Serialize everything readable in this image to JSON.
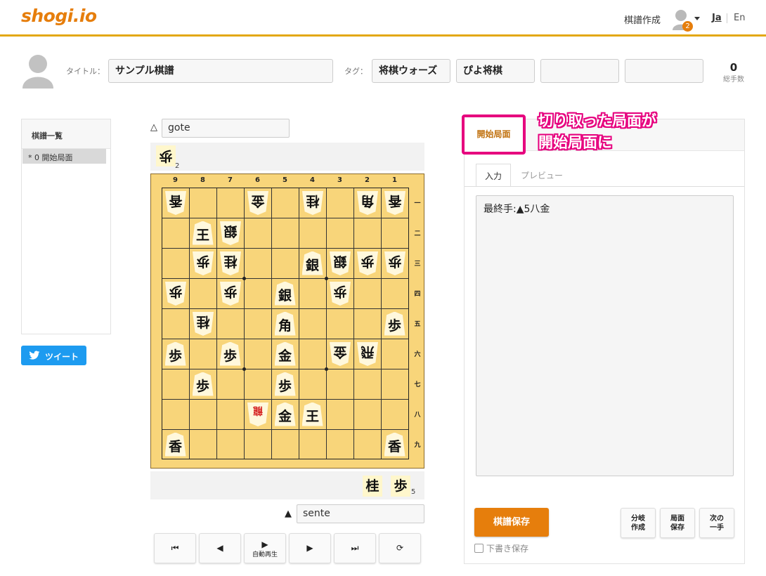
{
  "header": {
    "logo": "shogi.io",
    "create_link": "棋譜作成",
    "notification_count": "2",
    "lang_ja": "Ja",
    "lang_en": "En"
  },
  "meta": {
    "title_label": "タイトル：",
    "title_value": "サンプル棋譜",
    "tags_label": "タグ：",
    "tags": [
      "将棋ウォーズ",
      "ぴよ将棋",
      "",
      ""
    ],
    "moves_count": "0",
    "moves_label": "総手数"
  },
  "kifu_list": {
    "heading": "棋譜一覧",
    "items": [
      "*  0 開始局面"
    ]
  },
  "tweet_label": "ツイート",
  "players": {
    "gote_mark": "△",
    "gote_name": "gote",
    "sente_mark": "▲",
    "sente_name": "sente"
  },
  "gote_hand": [
    {
      "piece": "歩",
      "count": "2"
    }
  ],
  "sente_hand": [
    {
      "piece": "桂",
      "count": ""
    },
    {
      "piece": "歩",
      "count": "5"
    }
  ],
  "board": {
    "col_labels": [
      "9",
      "8",
      "7",
      "6",
      "5",
      "4",
      "3",
      "2",
      "1"
    ],
    "row_labels": [
      "一",
      "二",
      "三",
      "四",
      "五",
      "六",
      "七",
      "八",
      "九"
    ],
    "pieces": [
      {
        "file": 9,
        "rank": 1,
        "piece": "香",
        "owner": "gote"
      },
      {
        "file": 6,
        "rank": 1,
        "piece": "金",
        "owner": "gote"
      },
      {
        "file": 4,
        "rank": 1,
        "piece": "桂",
        "owner": "gote"
      },
      {
        "file": 2,
        "rank": 1,
        "piece": "角",
        "owner": "gote"
      },
      {
        "file": 1,
        "rank": 1,
        "piece": "香",
        "owner": "gote"
      },
      {
        "file": 8,
        "rank": 2,
        "piece": "王",
        "owner": "sente"
      },
      {
        "file": 7,
        "rank": 2,
        "piece": "銀",
        "owner": "gote"
      },
      {
        "file": 8,
        "rank": 3,
        "piece": "歩",
        "owner": "gote"
      },
      {
        "file": 7,
        "rank": 3,
        "piece": "桂",
        "owner": "gote"
      },
      {
        "file": 4,
        "rank": 3,
        "piece": "銀",
        "owner": "sente"
      },
      {
        "file": 3,
        "rank": 3,
        "piece": "銀",
        "owner": "gote"
      },
      {
        "file": 2,
        "rank": 3,
        "piece": "歩",
        "owner": "gote"
      },
      {
        "file": 1,
        "rank": 3,
        "piece": "歩",
        "owner": "gote"
      },
      {
        "file": 9,
        "rank": 4,
        "piece": "歩",
        "owner": "gote"
      },
      {
        "file": 7,
        "rank": 4,
        "piece": "歩",
        "owner": "gote"
      },
      {
        "file": 5,
        "rank": 4,
        "piece": "銀",
        "owner": "sente"
      },
      {
        "file": 3,
        "rank": 4,
        "piece": "歩",
        "owner": "gote"
      },
      {
        "file": 8,
        "rank": 5,
        "piece": "桂",
        "owner": "gote"
      },
      {
        "file": 5,
        "rank": 5,
        "piece": "角",
        "owner": "sente"
      },
      {
        "file": 1,
        "rank": 5,
        "piece": "歩",
        "owner": "sente"
      },
      {
        "file": 9,
        "rank": 6,
        "piece": "歩",
        "owner": "sente"
      },
      {
        "file": 7,
        "rank": 6,
        "piece": "歩",
        "owner": "sente"
      },
      {
        "file": 5,
        "rank": 6,
        "piece": "金",
        "owner": "sente"
      },
      {
        "file": 3,
        "rank": 6,
        "piece": "金",
        "owner": "gote"
      },
      {
        "file": 2,
        "rank": 6,
        "piece": "飛",
        "owner": "gote"
      },
      {
        "file": 8,
        "rank": 7,
        "piece": "歩",
        "owner": "sente"
      },
      {
        "file": 5,
        "rank": 7,
        "piece": "歩",
        "owner": "sente"
      },
      {
        "file": 6,
        "rank": 8,
        "piece": "龍",
        "owner": "gote",
        "promoted": true
      },
      {
        "file": 5,
        "rank": 8,
        "piece": "金",
        "owner": "sente"
      },
      {
        "file": 4,
        "rank": 8,
        "piece": "王",
        "owner": "sente"
      },
      {
        "file": 9,
        "rank": 9,
        "piece": "香",
        "owner": "sente"
      },
      {
        "file": 1,
        "rank": 9,
        "piece": "香",
        "owner": "sente"
      }
    ]
  },
  "nav_buttons": {
    "first": "⏮",
    "prev": "◀",
    "autoplay_glyph": "▶",
    "autoplay_label": "自動再生",
    "next": "▶",
    "last": "⏭",
    "flip": "⟳"
  },
  "right_panel": {
    "start_position": "開始局面",
    "annotation_line1": "切り取った局面が",
    "annotation_line2": "開始局面に",
    "tab_input": "入力",
    "tab_preview": "プレビュー",
    "comment_text": "最終手:▲5八金",
    "save_button": "棋譜保存",
    "draft_save": "下書き保存",
    "branch_line1": "分岐",
    "branch_line2": "作成",
    "position_save_line1": "局面",
    "position_save_line2": "保存",
    "next_move_line1": "次の",
    "next_move_line2": "一手"
  },
  "colors": {
    "accent": "#e67e0c",
    "header_border": "#e3a812",
    "board": "#f8d57a",
    "annotation": "#e6007e",
    "tweet": "#1d9bf0"
  }
}
